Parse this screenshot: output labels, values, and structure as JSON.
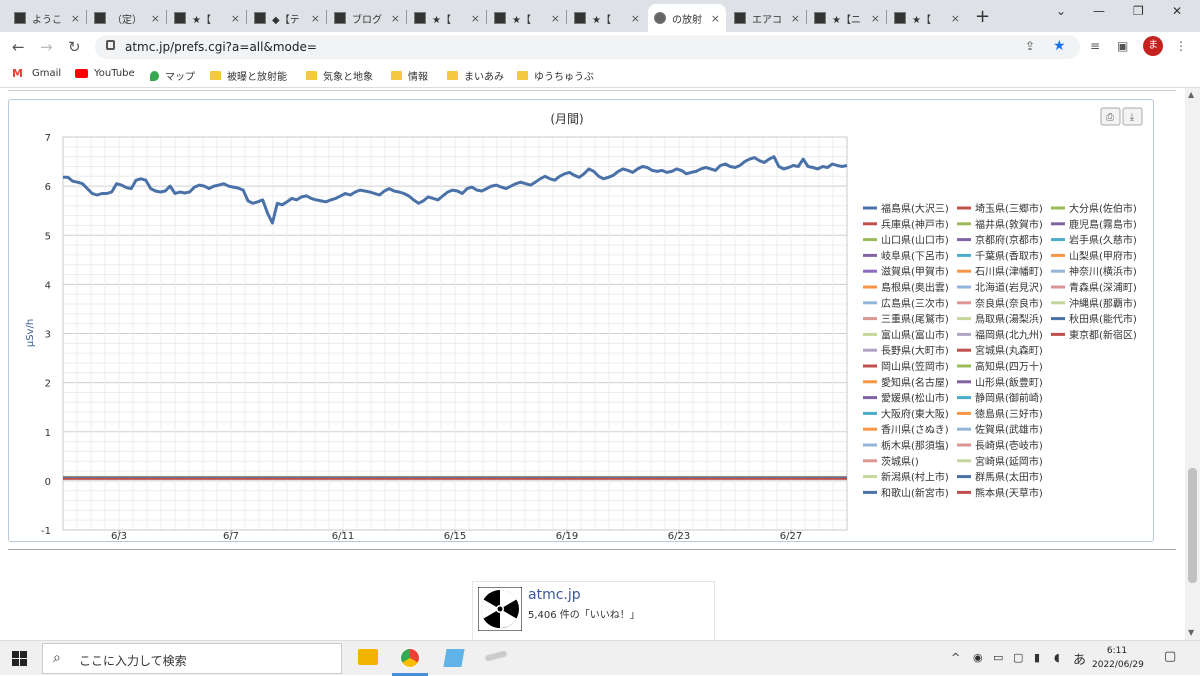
{
  "browser": {
    "tabs": [
      {
        "label": "ようこ"
      },
      {
        "label": "（定）"
      },
      {
        "label": "★【"
      },
      {
        "label": "◆【テ"
      },
      {
        "label": "ブログ"
      },
      {
        "label": "★【"
      },
      {
        "label": "★【"
      },
      {
        "label": "★【"
      },
      {
        "label": "の放射"
      },
      {
        "label": "エアコ"
      },
      {
        "label": "★【ニ"
      },
      {
        "label": "★【"
      }
    ],
    "url": "atmc.jp/prefs.cgi?a=all&mode=",
    "avatar": "ま",
    "bookmarks": [
      "Gmail",
      "YouTube",
      "マップ",
      "被曝と放射能",
      "気象と地象",
      "情報",
      "まいあみ",
      "ゆうちゅうぶ"
    ]
  },
  "chart_data": {
    "type": "line",
    "title": "(月間)",
    "ylabel": "μSv/h",
    "ylim": [
      -1,
      7
    ],
    "yticks": [
      "7",
      "6",
      "5",
      "4",
      "3",
      "2",
      "1",
      "0",
      "-1"
    ],
    "xticks": [
      "6/3",
      "6/7",
      "6/11",
      "6/15",
      "6/19",
      "6/23",
      "6/27"
    ],
    "x_range_days": [
      1,
      29
    ],
    "series": [
      {
        "name": "福島県(大沢三)",
        "color": "#4a72a8",
        "values": [
          6.18,
          6.18,
          6.1,
          6.08,
          6.05,
          5.95,
          5.85,
          5.82,
          5.85,
          5.85,
          5.88,
          6.05,
          6.02,
          5.97,
          5.95,
          6.12,
          6.15,
          6.12,
          5.95,
          5.9,
          5.88,
          5.9,
          6.0,
          5.85,
          5.88,
          5.86,
          5.88,
          5.98,
          6.02,
          6.0,
          5.95,
          6.0,
          6.02,
          6.05,
          6.0,
          5.98,
          5.96,
          5.92,
          5.7,
          5.65,
          5.68,
          5.72,
          5.45,
          5.25,
          5.65,
          5.62,
          5.68,
          5.75,
          5.72,
          5.78,
          5.8,
          5.75,
          5.72,
          5.7,
          5.68,
          5.72,
          5.75,
          5.8,
          5.85,
          5.82,
          5.88,
          5.92,
          5.9,
          5.88,
          5.85,
          5.82,
          5.9,
          5.95,
          5.9,
          5.88,
          5.85,
          5.8,
          5.72,
          5.65,
          5.7,
          5.78,
          5.75,
          5.72,
          5.8,
          5.88,
          5.92,
          5.9,
          5.85,
          5.95,
          5.98,
          5.92,
          5.9,
          5.95,
          6.0,
          6.02,
          5.98,
          5.95,
          6.0,
          6.05,
          6.08,
          6.05,
          6.02,
          6.08,
          6.15,
          6.2,
          6.15,
          6.12,
          6.2,
          6.25,
          6.28,
          6.22,
          6.18,
          6.25,
          6.35,
          6.3,
          6.2,
          6.15,
          6.18,
          6.22,
          6.3,
          6.35,
          6.32,
          6.28,
          6.35,
          6.4,
          6.38,
          6.32,
          6.3,
          6.32,
          6.28,
          6.3,
          6.35,
          6.32,
          6.25,
          6.28,
          6.3,
          6.35,
          6.38,
          6.35,
          6.32,
          6.42,
          6.45,
          6.4,
          6.38,
          6.42,
          6.5,
          6.55,
          6.58,
          6.52,
          6.48,
          6.55,
          6.6,
          6.4,
          6.35,
          6.38,
          6.42,
          6.4,
          6.55,
          6.4,
          6.38,
          6.35,
          6.4,
          6.38,
          6.45,
          6.42,
          6.4,
          6.42
        ]
      },
      {
        "name": "兵庫県(神戸市)",
        "color": "#c0504d",
        "values": [
          0.05,
          0.05
        ]
      },
      {
        "name": "山口県(山口市)",
        "color": "#9bbb59",
        "values": [
          0.08,
          0.08
        ]
      },
      {
        "name": "岐阜県(下呂市)",
        "color": "#8064a2",
        "values": [
          0.07,
          0.07
        ]
      },
      {
        "name": "滋賀県(甲賀市)",
        "color": "#8a6cc0",
        "values": [
          0.06,
          0.06
        ]
      },
      {
        "name": "島根県(奥出雲)",
        "color": "#f79646",
        "values": [
          0.07,
          0.07
        ]
      },
      {
        "name": "広島県(三次市)",
        "color": "#93b5d8",
        "values": [
          0.06,
          0.06
        ]
      },
      {
        "name": "三重県(尾鷲市)",
        "color": "#d99694",
        "values": [
          0.05,
          0.05
        ]
      },
      {
        "name": "富山県(富山市)",
        "color": "#c3d69b",
        "values": [
          0.06,
          0.06
        ]
      },
      {
        "name": "長野県(大町市)",
        "color": "#b3a2c7",
        "values": [
          0.07,
          0.07
        ]
      },
      {
        "name": "岡山県(笠岡市)",
        "color": "#c0504d",
        "values": [
          0.05,
          0.05
        ]
      },
      {
        "name": "愛知県(名古屋)",
        "color": "#f79646",
        "values": [
          0.06,
          0.06
        ]
      },
      {
        "name": "愛媛県(松山市)",
        "color": "#8064a2",
        "values": [
          0.06,
          0.06
        ]
      },
      {
        "name": "大阪府(東大阪)",
        "color": "#4bacc6",
        "values": [
          0.06,
          0.06
        ]
      },
      {
        "name": "香川県(さぬき)",
        "color": "#f79646",
        "values": [
          0.07,
          0.07
        ]
      },
      {
        "name": "栃木県(那須塩)",
        "color": "#93b5d8",
        "values": [
          0.07,
          0.07
        ]
      },
      {
        "name": "茨城県()",
        "color": "#d99694",
        "values": [
          0.06,
          0.06
        ]
      },
      {
        "name": "新潟県(村上市)",
        "color": "#c3d69b",
        "values": [
          0.06,
          0.06
        ]
      },
      {
        "name": "和歌山(新宮市)",
        "color": "#4a72a8",
        "values": [
          0.05,
          0.05
        ]
      },
      {
        "name": "埼玉県(三郷市)",
        "color": "#c0504d",
        "values": [
          0.05,
          0.05
        ]
      },
      {
        "name": "福井県(敦賀市)",
        "color": "#9bbb59",
        "values": [
          0.07,
          0.07
        ]
      },
      {
        "name": "京都府(京都市)",
        "color": "#8064a2",
        "values": [
          0.06,
          0.06
        ]
      },
      {
        "name": "千葉県(香取市)",
        "color": "#4bacc6",
        "values": [
          0.06,
          0.06
        ]
      },
      {
        "name": "石川県(津幡町)",
        "color": "#f79646",
        "values": [
          0.07,
          0.07
        ]
      },
      {
        "name": "北海道(岩見沢)",
        "color": "#93b5d8",
        "values": [
          0.05,
          0.05
        ]
      },
      {
        "name": "奈良県(奈良市)",
        "color": "#d99694",
        "values": [
          0.06,
          0.06
        ]
      },
      {
        "name": "鳥取県(湯梨浜)",
        "color": "#c3d69b",
        "values": [
          0.07,
          0.07
        ]
      },
      {
        "name": "福岡県(北九州)",
        "color": "#b3a2c7",
        "values": [
          0.06,
          0.06
        ]
      },
      {
        "name": "宮城県(丸森町)",
        "color": "#c0504d",
        "values": [
          0.07,
          0.07
        ]
      },
      {
        "name": "高知県(四万十)",
        "color": "#9bbb59",
        "values": [
          0.06,
          0.06
        ]
      },
      {
        "name": "山形県(飯豊町)",
        "color": "#8064a2",
        "values": [
          0.06,
          0.06
        ]
      },
      {
        "name": "静岡県(御前崎)",
        "color": "#4bacc6",
        "values": [
          0.06,
          0.06
        ]
      },
      {
        "name": "徳島県(三好市)",
        "color": "#f79646",
        "values": [
          0.07,
          0.07
        ]
      },
      {
        "name": "佐賀県(武雄市)",
        "color": "#93b5d8",
        "values": [
          0.06,
          0.06
        ]
      },
      {
        "name": "長崎県(壱岐市)",
        "color": "#d99694",
        "values": [
          0.06,
          0.06
        ]
      },
      {
        "name": "宮崎県(延岡市)",
        "color": "#c3d69b",
        "values": [
          0.05,
          0.05
        ]
      },
      {
        "name": "群馬県(太田市)",
        "color": "#4a72a8",
        "values": [
          0.06,
          0.06
        ]
      },
      {
        "name": "熊本県(天草市)",
        "color": "#c0504d",
        "values": [
          0.06,
          0.06
        ]
      },
      {
        "name": "大分県(佐伯市)",
        "color": "#9bbb59",
        "values": [
          0.07,
          0.07
        ]
      },
      {
        "name": "鹿児島(霧島市)",
        "color": "#8064a2",
        "values": [
          0.07,
          0.07
        ]
      },
      {
        "name": "岩手県(久慈市)",
        "color": "#4bacc6",
        "values": [
          0.06,
          0.06
        ]
      },
      {
        "name": "山梨県(甲府市)",
        "color": "#f79646",
        "values": [
          0.06,
          0.06
        ]
      },
      {
        "name": "神奈川(横浜市)",
        "color": "#93b5d8",
        "values": [
          0.06,
          0.06
        ]
      },
      {
        "name": "青森県(深浦町)",
        "color": "#d99694",
        "values": [
          0.05,
          0.05
        ]
      },
      {
        "name": "沖縄県(那覇市)",
        "color": "#c3d69b",
        "values": [
          0.06,
          0.06
        ]
      },
      {
        "name": "秋田県(能代市)",
        "color": "#4a72a8",
        "values": [
          0.06,
          0.06
        ]
      },
      {
        "name": "東京都(新宿区)",
        "color": "#c0504d",
        "values": [
          0.04,
          0.04
        ]
      }
    ]
  },
  "facebook": {
    "name": "atmc.jp",
    "likes": "5,406 件の「いいね！」"
  },
  "taskbar": {
    "search_placeholder": "ここに入力して検索",
    "time": "6:11",
    "date": "2022/06/29",
    "ime": "あ"
  }
}
